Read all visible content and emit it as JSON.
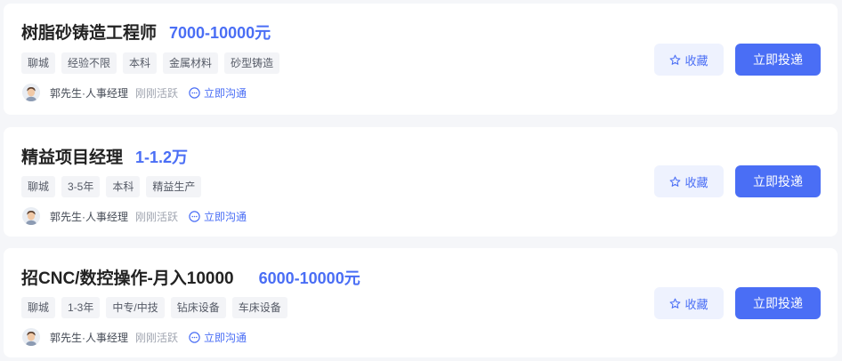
{
  "jobs": [
    {
      "title": "树脂砂铸造工程师",
      "salary": "7000-10000元",
      "tags": [
        "聊城",
        "经验不限",
        "本科",
        "金属材料",
        "砂型铸造"
      ],
      "recruiter": "郭先生·人事经理",
      "active_status": "刚刚活跃",
      "chat_label": "立即沟通",
      "favorite_label": "收藏",
      "apply_label": "立即投递"
    },
    {
      "title": "精益项目经理",
      "salary": "1-1.2万",
      "tags": [
        "聊城",
        "3-5年",
        "本科",
        "精益生产"
      ],
      "recruiter": "郭先生·人事经理",
      "active_status": "刚刚活跃",
      "chat_label": "立即沟通",
      "favorite_label": "收藏",
      "apply_label": "立即投递"
    },
    {
      "title": "招CNC/数控操作-月入10000",
      "salary": "6000-10000元",
      "tags": [
        "聊城",
        "1-3年",
        "中专/中技",
        "钻床设备",
        "车床设备"
      ],
      "recruiter": "郭先生·人事经理",
      "active_status": "刚刚活跃",
      "chat_label": "立即沟通",
      "favorite_label": "收藏",
      "apply_label": "立即投递"
    }
  ],
  "colors": {
    "accent": "#4a6ef5",
    "favorite_bg": "#eef2fe",
    "tag_bg": "#f3f4f7",
    "page_bg": "#f5f6f9"
  },
  "icons": {
    "favorite": "star-icon",
    "chat": "chat-bubble-icon",
    "avatar": "avatar"
  }
}
